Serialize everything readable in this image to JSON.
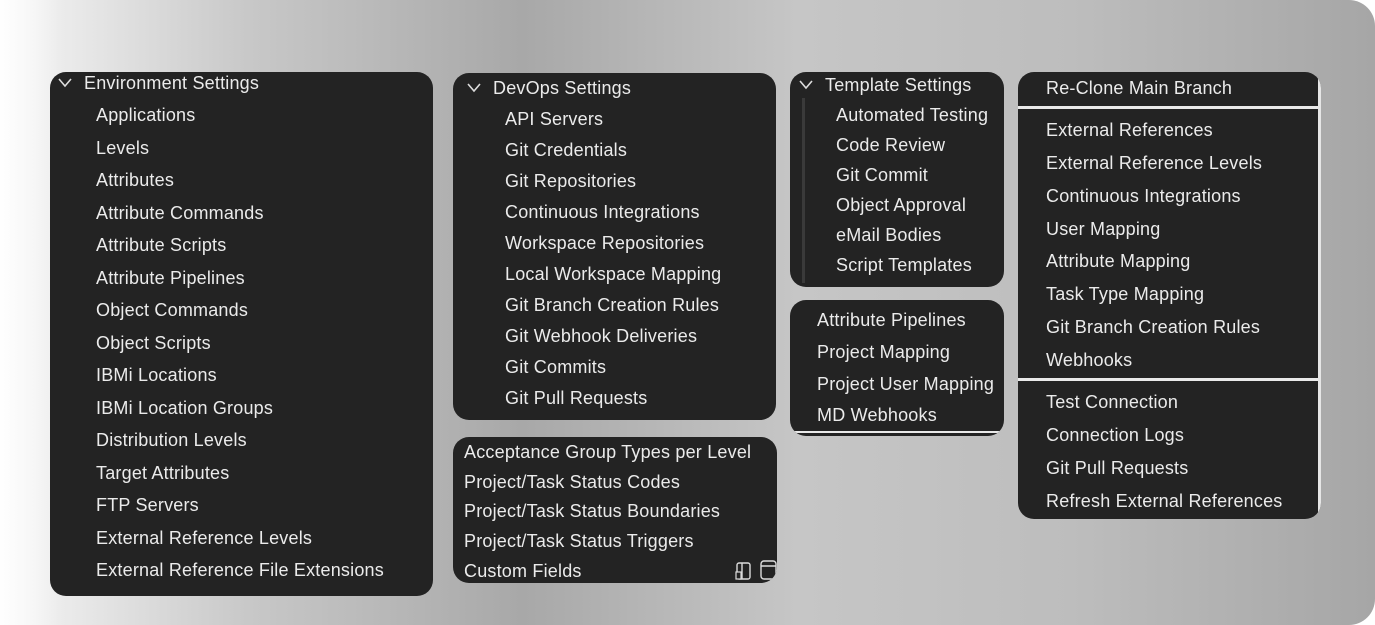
{
  "environment": {
    "header": "Environment Settings",
    "items": [
      "Applications",
      "Levels",
      "Attributes",
      "Attribute Commands",
      "Attribute Scripts",
      "Attribute Pipelines",
      "Object Commands",
      "Object Scripts",
      "IBMi Locations",
      "IBMi Location Groups",
      "Distribution Levels",
      "Target Attributes",
      "FTP Servers",
      "External Reference Levels",
      "External Reference File Extensions"
    ]
  },
  "devops": {
    "header": "DevOps Settings",
    "items": [
      "API Servers",
      "Git Credentials",
      "Git Repositories",
      "Continuous Integrations",
      "Workspace Repositories",
      "Local Workspace Mapping",
      "Git Branch Creation Rules",
      "Git Webhook Deliveries",
      "Git Commits",
      "Git Pull Requests"
    ]
  },
  "project": {
    "items": [
      "Acceptance Group Types per Level",
      "Project/Task Status Codes",
      "Project/Task Status Boundaries",
      "Project/Task Status Triggers",
      "Custom Fields"
    ],
    "icons": [
      "sidebar-icon",
      "panel-icon"
    ]
  },
  "template": {
    "header": "Template Settings",
    "items": [
      "Automated Testing",
      "Code Review",
      "Git Commit",
      "Object Approval",
      "eMail Bodies",
      "Script Templates"
    ]
  },
  "mapping": {
    "items": [
      "Attribute Pipelines",
      "Project Mapping",
      "Project User Mapping",
      "MD Webhooks"
    ]
  },
  "actions": {
    "top": [
      "Re-Clone Main Branch"
    ],
    "middle": [
      "External References",
      "External Reference Levels",
      "Continuous Integrations",
      "User Mapping",
      "Attribute Mapping",
      "Task Type Mapping",
      "Git Branch Creation Rules",
      "Webhooks"
    ],
    "bottom": [
      "Test Connection",
      "Connection Logs",
      "Git Pull Requests",
      "Refresh External References"
    ]
  }
}
